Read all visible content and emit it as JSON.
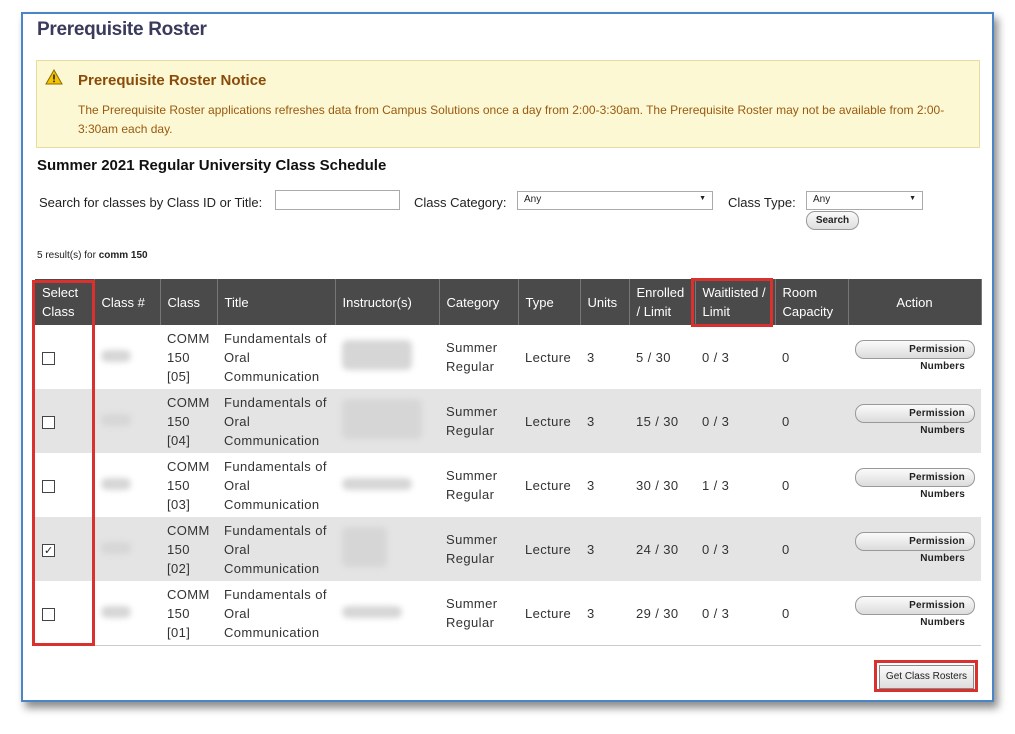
{
  "page": {
    "title": "Prerequisite Roster"
  },
  "notice": {
    "icon": "warning-icon",
    "title": "Prerequisite Roster Notice",
    "text": "The Prerequisite Roster applications refreshes data from Campus Solutions once a day from 2:00-3:30am. The Prerequisite Roster may not be available from 2:00-3:30am each day."
  },
  "schedule": {
    "title": "Summer 2021 Regular University Class Schedule"
  },
  "search": {
    "id_label": "Search for classes by Class ID or Title:",
    "id_value": "",
    "category_label": "Class Category:",
    "category_value": "Any",
    "type_label": "Class Type:",
    "type_value": "Any",
    "button": "Search"
  },
  "results": {
    "prefix": "5 result(s) for",
    "query": "comm 150"
  },
  "table": {
    "headers": {
      "select": "Select Class",
      "class_num": "Class #",
      "class": "Class",
      "title": "Title",
      "instructor": "Instructor(s)",
      "category": "Category",
      "type": "Type",
      "units": "Units",
      "enrolled": "Enrolled / Limit",
      "waitlisted": "Waitlisted / Limit",
      "room": "Room Capacity",
      "action": "Action"
    },
    "rows": [
      {
        "checked": false,
        "class": "COMM 150 [05]",
        "title": "Fundamentals of Oral Communication",
        "category": "Summer Regular",
        "type": "Lecture",
        "units": "3",
        "enrolled": "5 / 30",
        "waitlisted": "0 / 3",
        "room": "0",
        "action": "Permission Numbers"
      },
      {
        "checked": false,
        "class": "COMM 150 [04]",
        "title": "Fundamentals of Oral Communication",
        "category": "Summer Regular",
        "type": "Lecture",
        "units": "3",
        "enrolled": "15 / 30",
        "waitlisted": "0 / 3",
        "room": "0",
        "action": "Permission Numbers"
      },
      {
        "checked": false,
        "class": "COMM 150 [03]",
        "title": "Fundamentals of Oral Communication",
        "category": "Summer Regular",
        "type": "Lecture",
        "units": "3",
        "enrolled": "30 / 30",
        "waitlisted": "1 / 3",
        "room": "0",
        "action": "Permission Numbers"
      },
      {
        "checked": true,
        "class": "COMM 150 [02]",
        "title": "Fundamentals of Oral Communication",
        "category": "Summer Regular",
        "type": "Lecture",
        "units": "3",
        "enrolled": "24 / 30",
        "waitlisted": "0 / 3",
        "room": "0",
        "action": "Permission Numbers"
      },
      {
        "checked": false,
        "class": "COMM 150 [01]",
        "title": "Fundamentals of Oral Communication",
        "category": "Summer Regular",
        "type": "Lecture",
        "units": "3",
        "enrolled": "29 / 30",
        "waitlisted": "0 / 3",
        "room": "0",
        "action": "Permission Numbers"
      }
    ]
  },
  "footer": {
    "get_rosters": "Get Class Rosters"
  },
  "colors": {
    "highlight": "#d9322e",
    "header_bg": "#4a4a4a",
    "notice_bg": "#fcf8d4",
    "window_border": "#4a86c6"
  }
}
